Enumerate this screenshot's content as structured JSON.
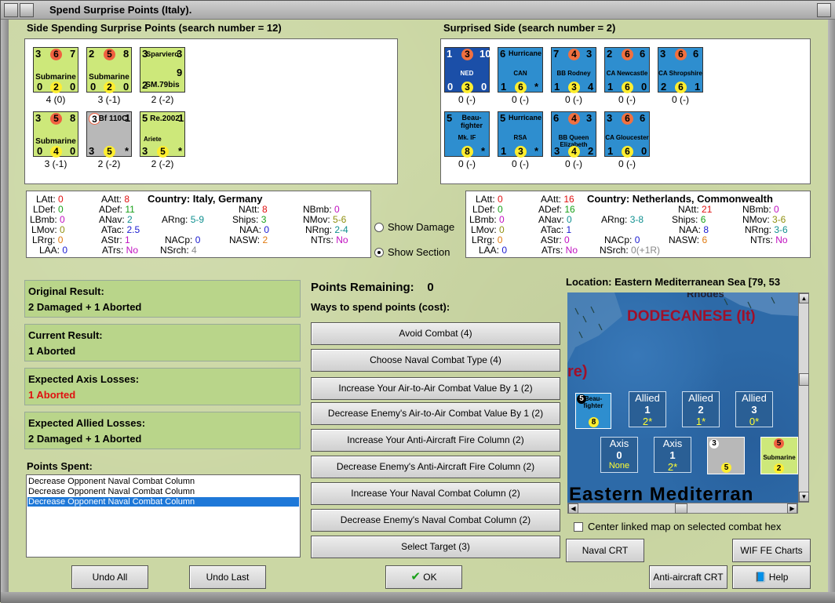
{
  "window": {
    "title": "Spend Surprise Points (Italy)."
  },
  "left_side": {
    "header": "Side Spending Surprise Points (search number = 12)",
    "counters": [
      {
        "top": "3",
        "mid": "6",
        "right": "7",
        "name": "Submarine",
        "b1": "0",
        "b2": "2",
        "b3": "0",
        "below": "4 (0)"
      },
      {
        "top": "2",
        "mid": "5",
        "right": "8",
        "name": "Submarine",
        "b1": "0",
        "b2": "2",
        "b3": "0",
        "below": "3 (-1)"
      },
      {
        "top": "3",
        "sub": "Sparviero",
        "right": "3",
        "name": "SM.79bis",
        "b1": "2",
        "b2": "2",
        "b3": "9",
        "below": "2 (-2)"
      },
      {
        "top": "3",
        "mid": "5",
        "right": "8",
        "name": "Submarine",
        "b1": "0",
        "b2": "4",
        "b3": "0",
        "below": "3 (-1)"
      },
      {
        "top": "3",
        "sub": "Bf 110C",
        "right": "1",
        "name": "",
        "b1": "3",
        "b2": "5",
        "b3": "*",
        "below": "2 (-2)"
      },
      {
        "top": "5",
        "sub": "Re.2002",
        "right": "1",
        "name": "Ariete",
        "b1": "3",
        "b2": "5",
        "b3": "*",
        "below": "2 (-2)"
      }
    ]
  },
  "right_side": {
    "header": "Surprised Side (search number = 2)",
    "counters": [
      {
        "top": "1",
        "mid": "3",
        "right": "10",
        "name": "NED",
        "b1": "0",
        "b2": "3",
        "b3": "0",
        "below": "0 (-)"
      },
      {
        "top": "6",
        "sub": "Hurricane",
        "name": "CAN",
        "b1": "1",
        "b2": "6",
        "b3": "*",
        "below": "0 (-)"
      },
      {
        "top": "7",
        "mid": "4",
        "right": "3",
        "name": "BB Rodney",
        "b1": "1",
        "b2": "3",
        "b3": "4",
        "below": "0 (-)"
      },
      {
        "top": "2",
        "mid": "6",
        "right": "6",
        "name": "CA Newcastle",
        "b1": "1",
        "b2": "6",
        "b3": "0",
        "below": "0 (-)"
      },
      {
        "top": "3",
        "mid": "6",
        "right": "6",
        "name": "CA Shropshire",
        "b1": "2",
        "b2": "6",
        "b3": "1",
        "below": "0 (-)"
      },
      {
        "top": "5",
        "sub": "Beau-fighter",
        "name": "Mk. IF",
        "b1": "",
        "b2": "8",
        "b3": "*",
        "below": "0 (-)"
      },
      {
        "top": "5",
        "sub": "Hurricane",
        "name": "RSA",
        "b1": "1",
        "b2": "3",
        "b3": "*",
        "below": "0 (-)"
      },
      {
        "top": "6",
        "mid": "4",
        "right": "3",
        "name": "BB Queen Elizabeth",
        "b1": "3",
        "b2": "4",
        "b3": "2",
        "below": "0 (-)"
      },
      {
        "top": "3",
        "mid": "6",
        "right": "6",
        "name": "CA Gloucester",
        "b1": "1",
        "b2": "6",
        "b3": "0",
        "below": "0 (-)"
      }
    ]
  },
  "stats_left": {
    "country_label": "Country:",
    "country": "Italy, Germany",
    "LAtt": "0",
    "LDef": "0",
    "LBmb": "0",
    "LMov": "0",
    "LRrg": "0",
    "LAA": "0",
    "AAtt": "8",
    "ADef": "11",
    "ANav": "2",
    "ATac": "2.5",
    "AStr": "1",
    "ATrs": "No",
    "ARng": "5-9",
    "NACp": "0",
    "NSrch": "4",
    "NAtt": "8",
    "Ships": "3",
    "NAA": "0",
    "NASW": "2",
    "NBmb": "0",
    "NMov": "5-6",
    "NRng": "2-4",
    "NTrs": "No"
  },
  "stats_right": {
    "country_label": "Country:",
    "country": "Netherlands, Commonwealth",
    "LAtt": "0",
    "LDef": "0",
    "LBmb": "0",
    "LMov": "0",
    "LRrg": "0",
    "LAA": "0",
    "AAtt": "16",
    "ADef": "16",
    "ANav": "0",
    "ATac": "1",
    "AStr": "0",
    "ATrs": "No",
    "ARng": "3-8",
    "NACp": "0",
    "NSrch": "0(+1R)",
    "NAtt": "21",
    "Ships": "6",
    "NAA": "8",
    "NASW": "6",
    "NBmb": "0",
    "NMov": "3-6",
    "NRng": "3-6",
    "NTrs": "No"
  },
  "options": {
    "show_damage": "Show Damage",
    "show_section": "Show Section"
  },
  "results": {
    "original_label": "Original Result:",
    "original": "2 Damaged + 1 Aborted",
    "current_label": "Current Result:",
    "current": "1 Aborted",
    "axis_label": "Expected Axis Losses:",
    "axis": "1 Aborted",
    "allied_label": "Expected Allied Losses:",
    "allied": "2 Damaged + 1 Aborted"
  },
  "points_spent": {
    "label": "Points Spent:",
    "items": [
      "Decrease Opponent Naval Combat Column",
      "Decrease Opponent Naval Combat Column",
      "Decrease Opponent Naval Combat Column"
    ]
  },
  "points": {
    "remaining_label": "Points Remaining:",
    "remaining": "0",
    "ways_label": "Ways to spend points (cost):"
  },
  "actions": [
    "Avoid Combat (4)",
    "Choose Naval Combat Type (4)",
    "Increase Your Air-to-Air Combat Value By 1 (2)",
    "Decrease Enemy's Air-to-Air Combat Value By 1 (2)",
    "Increase Your Anti-Aircraft Fire Column (2)",
    "Decrease Enemy's Anti-Aircraft Fire Column (2)",
    "Increase Your Naval Combat Column (2)",
    "Decrease Enemy's Naval Combat Column (2)",
    "Select Target (3)"
  ],
  "map": {
    "location": "Location: Eastern Mediterranean Sea [79, 53",
    "rhodes": "Rhodes",
    "dodecanese": "DODECANESE (It)",
    "re": "re)",
    "sea_name": "Eastern Mediterran",
    "allied_boxes": [
      {
        "t": "Allied",
        "n": "1",
        "v": "2*"
      },
      {
        "t": "Allied",
        "n": "2",
        "v": "1*"
      },
      {
        "t": "Allied",
        "n": "3",
        "v": "0*"
      }
    ],
    "axis_boxes": [
      {
        "t": "Axis",
        "n": "0",
        "v": "None"
      },
      {
        "t": "Axis",
        "n": "1",
        "v": "2*"
      }
    ],
    "center_linked": "Center linked map on selected combat hex"
  },
  "buttons": {
    "undo_all": "Undo All",
    "undo_last": "Undo Last",
    "ok": "OK",
    "naval_crt": "Naval CRT",
    "wif_fe": "WIF FE Charts",
    "aa_crt": "Anti-aircraft CRT",
    "help": "Help"
  }
}
